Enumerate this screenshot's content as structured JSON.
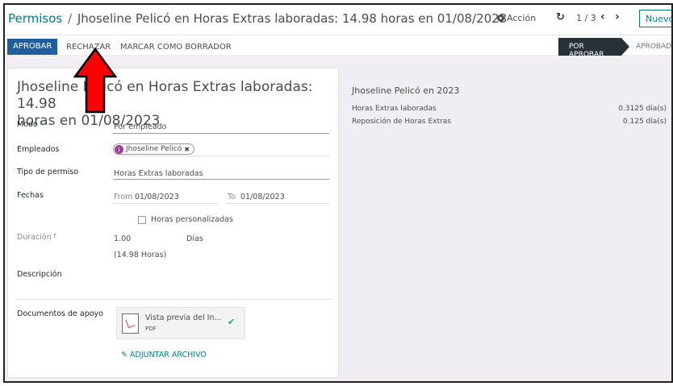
{
  "breadcrumb": {
    "root": "Permisos",
    "separator": "/",
    "current": "Jhoseline Pelicó en Horas Extras laboradas: 14.98 horas en 01/08/2023"
  },
  "toolbar": {
    "action_label": "Acción",
    "pager": "1 / 3",
    "new_label": "Nuevo"
  },
  "statusbar": {
    "approve_label": "APROBAR",
    "refuse_label": "RECHAZAR",
    "draft_label": "MARCAR COMO BORRADOR",
    "stages": [
      "POR APROBAR",
      "APROBAD"
    ],
    "active_stage": "POR APROBAR"
  },
  "form": {
    "title_line1": "Jhoseline Pelicó en Horas Extras laboradas: 14.98",
    "title_line2": "horas en 01/08/2023",
    "mode_label": "Modo",
    "mode_value": "Por empleado",
    "employees_label": "Empleados",
    "employee_initial": "J",
    "employee_name": "Jhoseline Pelicó",
    "leave_type_label": "Tipo de permiso",
    "leave_type_value": "Horas Extras laboradas",
    "dates_label": "Fechas",
    "from_label": "From",
    "from_value": "01/08/2023",
    "to_label": "To",
    "to_value": "01/08/2023",
    "custom_hours_label": "Horas personalizadas",
    "custom_hours_checked": false,
    "duration_label": "Duración",
    "duration_value": "1.00",
    "duration_unit": "Días",
    "duration_hours": "(14.98 Horas)",
    "description_label": "Descripción",
    "support_docs_label": "Documentos de apoyo",
    "attachment_name": "Vista previa del In...",
    "attachment_type": "PDF",
    "attach_link": "ADJUNTAR ARCHIVO"
  },
  "summary": {
    "title": "Jhoseline Pelicó en 2023",
    "rows": [
      {
        "label": "Horas Extras laboradas",
        "value": "0.3125 día(s)"
      },
      {
        "label": "Reposición de Horas Extras",
        "value": "0.125 día(s)"
      }
    ]
  },
  "colors": {
    "accent": "#017e84",
    "primary_button": "#1f5f9e",
    "active_stage": "#283138",
    "annotation_arrow": "#ff0000"
  }
}
